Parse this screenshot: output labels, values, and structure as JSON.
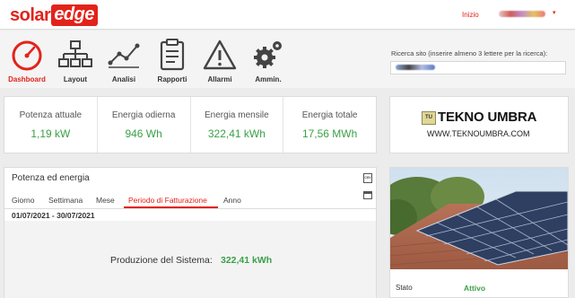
{
  "brand": {
    "solar": "solar",
    "edge": "edge",
    "accent": "#e2231a",
    "green": "#3aa047"
  },
  "topnav": {
    "start": "Inizio"
  },
  "tabs": [
    {
      "label": "Dashboard",
      "icon": "gauge-icon"
    },
    {
      "label": "Layout",
      "icon": "hierarchy-icon"
    },
    {
      "label": "Analisi",
      "icon": "line-chart-icon"
    },
    {
      "label": "Rapporti",
      "icon": "clipboard-icon"
    },
    {
      "label": "Allarmi",
      "icon": "warning-icon"
    },
    {
      "label": "Ammin.",
      "icon": "gears-icon"
    }
  ],
  "search": {
    "label": "Ricerca sito (inserire almeno 3 lettere per la ricerca):"
  },
  "kpis": [
    {
      "label": "Potenza attuale",
      "value": "1,19 kW"
    },
    {
      "label": "Energia odierna",
      "value": "946 Wh"
    },
    {
      "label": "Energia mensile",
      "value": "322,41 kWh"
    },
    {
      "label": "Energia totale",
      "value": "17,56 MWh"
    }
  ],
  "installer": {
    "badge": "TU",
    "name": "TEKNO UMBRA",
    "website": "WWW.TEKNOUMBRA.COM"
  },
  "power_energy": {
    "title": "Potenza ed energia",
    "csv_label": "CSV",
    "tabs": [
      "Giorno",
      "Settimana",
      "Mese",
      "Periodo di Fatturazione",
      "Anno"
    ],
    "active_tab": "Periodo di Fatturazione",
    "date_range": "01/07/2021 - 30/07/2021",
    "production_label": "Produzione del Sistema:",
    "production_value": "322,41 kWh"
  },
  "site": {
    "status_label": "Stato",
    "status_value": "Attivo"
  }
}
